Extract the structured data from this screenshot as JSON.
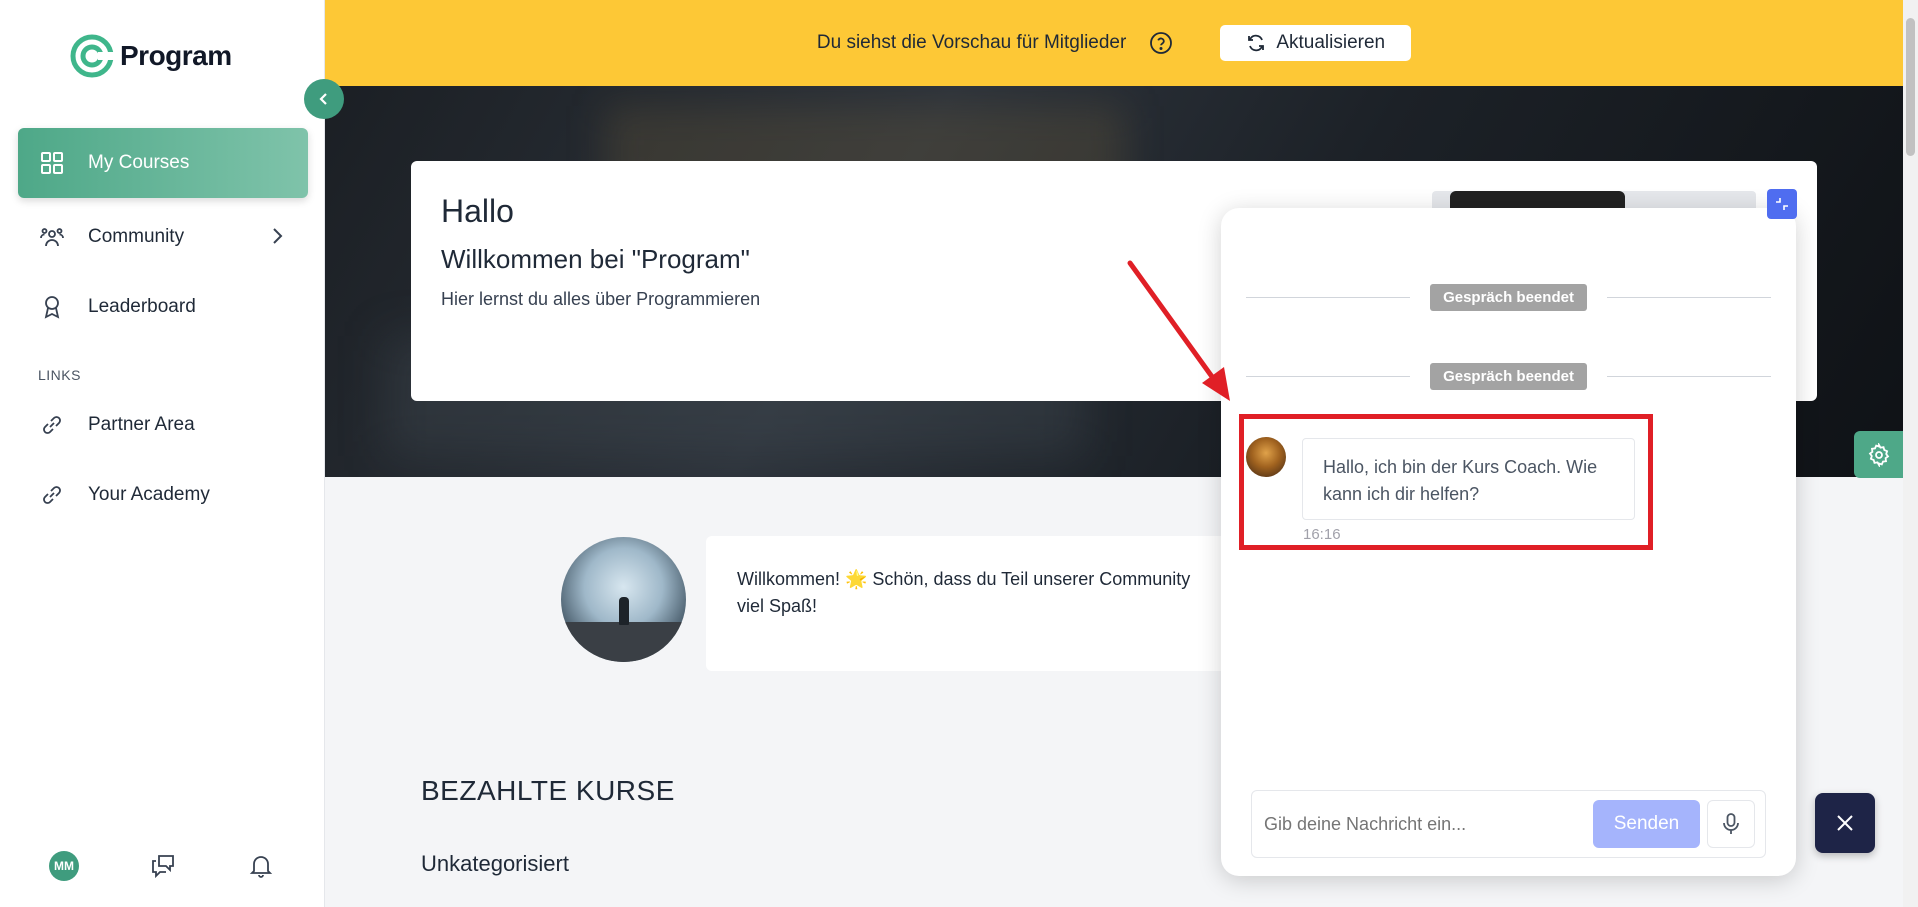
{
  "sidebar": {
    "logo_text": "Program",
    "items": [
      {
        "label": "My Courses"
      },
      {
        "label": "Community"
      },
      {
        "label": "Leaderboard"
      }
    ],
    "links_heading": "LINKS",
    "links": [
      {
        "label": "Partner Area"
      },
      {
        "label": "Your Academy"
      }
    ],
    "user_initials": "MM"
  },
  "banner": {
    "text": "Du siehst die Vorschau für Mitglieder",
    "refresh_label": "Aktualisieren"
  },
  "hero": {
    "title": "Hallo",
    "subtitle": "Willkommen bei \"Program\"",
    "description": "Hier lernst du alles über Programmieren"
  },
  "welcome": {
    "line1": "Willkommen! 🌟 Schön, dass du Teil unserer Community",
    "line2": "viel Spaß!"
  },
  "courses": {
    "section_title": "BEZAHLTE KURSE",
    "category": "Unkategorisiert"
  },
  "chat": {
    "divider_label_1": "Gespräch beendet",
    "divider_label_2": "Gespräch beendet",
    "message": "Hallo, ich bin der Kurs Coach. Wie kann ich dir helfen?",
    "time": "16:16",
    "input_placeholder": "Gib deine Nachricht ein...",
    "send_label": "Senden"
  },
  "colors": {
    "accent": "#3f9c7e",
    "banner": "#fdc836",
    "highlight": "#e01f26",
    "send": "#a5b4fc",
    "close": "#1e2447"
  }
}
